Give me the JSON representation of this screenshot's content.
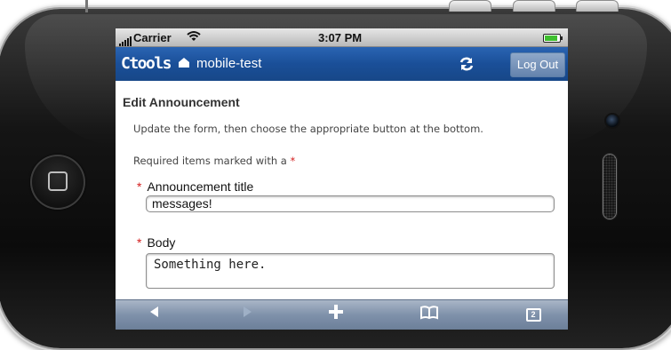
{
  "status_bar": {
    "carrier": "Carrier",
    "time": "3:07 PM",
    "battery_level": 1.0
  },
  "nav_bar": {
    "brand": "Ctools",
    "site_name": "mobile-test",
    "logout_label": "Log Out"
  },
  "form": {
    "title": "Edit Announcement",
    "instructions": "Update the form, then choose the appropriate button at the bottom.",
    "required_note": "Required items marked with a",
    "required_marker": "*",
    "fields": [
      {
        "label": "Announcement title",
        "value": "messages!"
      },
      {
        "label": "Body",
        "value": "Something here."
      }
    ]
  },
  "toolbar": {
    "tabs_count": "2"
  },
  "colors": {
    "nav_blue": "#1a4f98",
    "required_red": "#d41f1f"
  },
  "icons": [
    "signal-icon",
    "wifi-icon",
    "battery-icon",
    "home-icon",
    "sync-icon",
    "back-arrow-icon",
    "forward-arrow-icon",
    "add-icon",
    "bookmarks-icon",
    "pages-icon"
  ]
}
